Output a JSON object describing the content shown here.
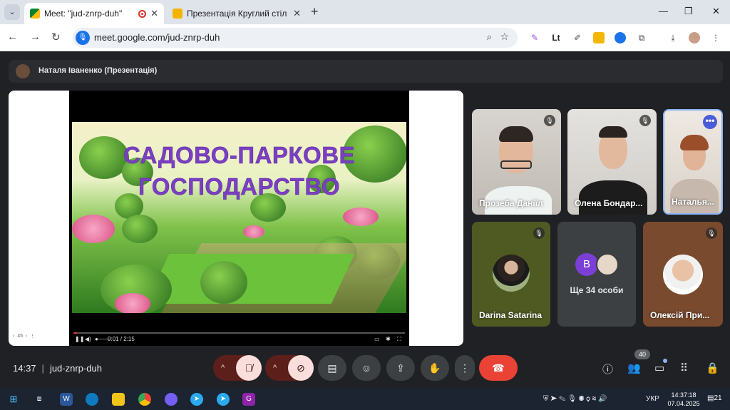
{
  "browser": {
    "tabs": [
      {
        "title": "Meet: \"jud-znrp-duh\"",
        "favicon": "google-meet-icon",
        "recording": true
      },
      {
        "title": "Презентація Круглий стіл «Мо",
        "favicon": "google-slides-icon"
      }
    ],
    "url": "meet.google.com/jud-znrp-duh"
  },
  "presenter_bar": {
    "text": "Наталя Іваненко (Презентація)"
  },
  "slide": {
    "title_line1": "САДОВО-ПАРКОВЕ",
    "title_line2": "ГОСПОДАРСТВО",
    "progress": 0.01,
    "time": "0:01 / 2:15",
    "page": "45"
  },
  "participants": [
    {
      "name": "Прозеба Даніїл",
      "muted": true
    },
    {
      "name": "Олена Бондар...",
      "muted": true
    },
    {
      "name": "Наталья...",
      "muted": false,
      "more_menu": true
    },
    {
      "name": "Darina Satarina",
      "muted": true
    },
    {
      "name": "Ще 34 особи",
      "avatar_letter": "B"
    },
    {
      "name": "Олексій При...",
      "muted": true
    }
  ],
  "meeting": {
    "time": "14:37",
    "code": "jud-znrp-duh",
    "participant_count": "40"
  },
  "taskbar": {
    "lang": "УКР",
    "time": "14:37:18",
    "date": "07.04.2025",
    "notifications": "21"
  },
  "colors": {
    "meet_bg": "#202124",
    "end_call": "#ea4335",
    "muted_inner": "#f9dedc",
    "accent_blue": "#1a73e8",
    "slide_title": "#7b3fc4"
  }
}
